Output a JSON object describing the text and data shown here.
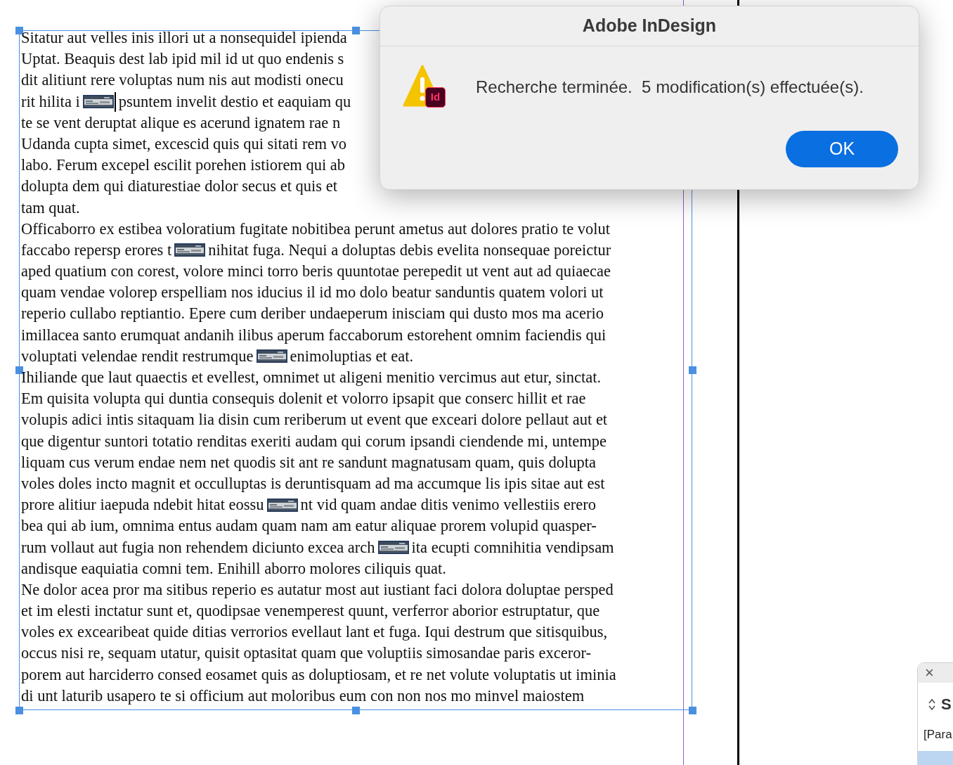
{
  "document": {
    "lines": [
      {
        "segments": [
          {
            "kind": "text",
            "text": "Sitatur aut velles inis illori ut a nonsequidel ipienda"
          }
        ]
      },
      {
        "segments": [
          {
            "kind": "text",
            "text": "Uptat. Beaquis dest lab ipid mil id ut quo endenis s"
          }
        ]
      },
      {
        "segments": [
          {
            "kind": "text",
            "text": "dit alitiunt rere voluptas num nis aut modisti onecu"
          }
        ]
      },
      {
        "segments": [
          {
            "kind": "text",
            "text": "rit hilita i"
          },
          {
            "kind": "picture",
            "cursor": true
          },
          {
            "kind": "text",
            "text": "psuntem invelit destio et eaquiam qu"
          }
        ]
      },
      {
        "segments": [
          {
            "kind": "text",
            "text": "te se vent deruptat alique es acerund ignatem rae n"
          }
        ]
      },
      {
        "segments": [
          {
            "kind": "text",
            "text": "Udanda cupta simet, excescid quis qui sitati rem vo"
          }
        ]
      },
      {
        "segments": [
          {
            "kind": "text",
            "text": "labo. Ferum excepel escilit porehen istiorem qui ab"
          }
        ]
      },
      {
        "segments": [
          {
            "kind": "text",
            "text": "dolupta dem qui diaturestiae dolor secus et quis et"
          }
        ]
      },
      {
        "segments": [
          {
            "kind": "text",
            "text": "tam quat."
          }
        ]
      },
      {
        "segments": [
          {
            "kind": "text",
            "text": "Officaborro ex estibea voloratium fugitate nobitibea perunt ametus aut dolores pratio te volut"
          }
        ]
      },
      {
        "segments": [
          {
            "kind": "text",
            "text": "faccabo repersp erores t"
          },
          {
            "kind": "picture",
            "cursor": false
          },
          {
            "kind": "text",
            "text": "nihitat fuga. Nequi a doluptas debis evelita nonsequae poreictur"
          }
        ]
      },
      {
        "segments": [
          {
            "kind": "text",
            "text": "aped quatium con corest, volore minci torro beris quuntotae perepedit ut vent aut ad quiaecae"
          }
        ]
      },
      {
        "segments": [
          {
            "kind": "text",
            "text": "quam vendae volorep erspelliam nos iducius il id mo dolo beatur sanduntis quatem volori ut"
          }
        ]
      },
      {
        "segments": [
          {
            "kind": "text",
            "text": "reperio cullabo reptiantio. Epere cum deriber undaeperum inisciam qui dusto mos ma acerio"
          }
        ]
      },
      {
        "segments": [
          {
            "kind": "text",
            "text": "imillacea santo erumquat andanih ilibus aperum faccaborum estorehent omnim faciendis qui"
          }
        ]
      },
      {
        "segments": [
          {
            "kind": "text",
            "text": "voluptati velendae rendit restrumque"
          },
          {
            "kind": "picture",
            "cursor": false
          },
          {
            "kind": "text",
            "text": "enimoluptias et eat."
          }
        ]
      },
      {
        "segments": [
          {
            "kind": "text",
            "text": "Ihiliande que laut quaectis et evellest, omnimet ut aligeni menitio vercimus aut etur, sinctat."
          }
        ]
      },
      {
        "segments": [
          {
            "kind": "text",
            "text": "Em quisita volupta qui duntia consequis dolenit et volorro ipsapit que conserc hillit et rae"
          }
        ]
      },
      {
        "segments": [
          {
            "kind": "text",
            "text": "volupis adici intis sitaquam lia disin cum reriberum ut event que exceari dolore pellaut aut et"
          }
        ]
      },
      {
        "segments": [
          {
            "kind": "text",
            "text": "que digentur suntori totatio renditas exeriti audam qui corum ipsandi ciendende mi, untempe"
          }
        ]
      },
      {
        "segments": [
          {
            "kind": "text",
            "text": "liquam cus verum endae nem net quodis sit ant re sandunt magnatusam quam, quis dolupta"
          }
        ]
      },
      {
        "segments": [
          {
            "kind": "text",
            "text": "voles doles incto magnit et occulluptas is deruntisquam ad ma accumque lis ipis sitae aut est"
          }
        ]
      },
      {
        "segments": [
          {
            "kind": "text",
            "text": "prore alitiur iaepuda ndebit hitat eossu"
          },
          {
            "kind": "picture",
            "cursor": false
          },
          {
            "kind": "text",
            "text": "nt vid quam andae ditis venimo vellestiis erero"
          }
        ]
      },
      {
        "segments": [
          {
            "kind": "text",
            "text": "bea qui ab ium, omnima entus audam quam nam am eatur aliquae prorem volupid quasper-"
          }
        ]
      },
      {
        "segments": [
          {
            "kind": "text",
            "text": "rum vollaut aut fugia non rehendem diciunto excea arch"
          },
          {
            "kind": "picture",
            "cursor": false
          },
          {
            "kind": "text",
            "text": "ita ecupti comnihitia vendipsam"
          }
        ]
      },
      {
        "segments": [
          {
            "kind": "text",
            "text": "andisque eaquiatia comni tem. Enihill aborro molores ciliquis quat."
          }
        ]
      },
      {
        "segments": [
          {
            "kind": "text",
            "text": "Ne dolor acea pror ma sitibus reperio es autatur most aut iustiant faci dolora doluptae persped"
          }
        ]
      },
      {
        "segments": [
          {
            "kind": "text",
            "text": "et im elesti inctatur sunt et, quodipsae venemperest quunt, verferror aborior estruptatur, que"
          }
        ]
      },
      {
        "segments": [
          {
            "kind": "text",
            "text": "voles ex excearibeat quide ditias verrorios evellaut lant et fuga. Iqui destrum que sitisquibus,"
          }
        ]
      },
      {
        "segments": [
          {
            "kind": "text",
            "text": "occus nisi re, sequam utatur, quisit optasitat quam que voluptiis simosandae paris exceror-"
          }
        ]
      },
      {
        "segments": [
          {
            "kind": "text",
            "text": "porem aut harciderro consed eosamet quis as doluptiosam, et re net volute voluptatis ut iminia"
          }
        ]
      },
      {
        "segments": [
          {
            "kind": "text",
            "text": "di unt laturib usapero te si officium aut moloribus eum con non nos mo minvel maiostem"
          }
        ]
      }
    ]
  },
  "dialog": {
    "title": "Adobe InDesign",
    "badge": "Id",
    "message": "Recherche terminée.  5 modification(s) effectuée(s).",
    "buttons": [
      {
        "label": "OK"
      }
    ]
  },
  "panel": {
    "close": "×",
    "heading": "S",
    "item": "[Para"
  }
}
